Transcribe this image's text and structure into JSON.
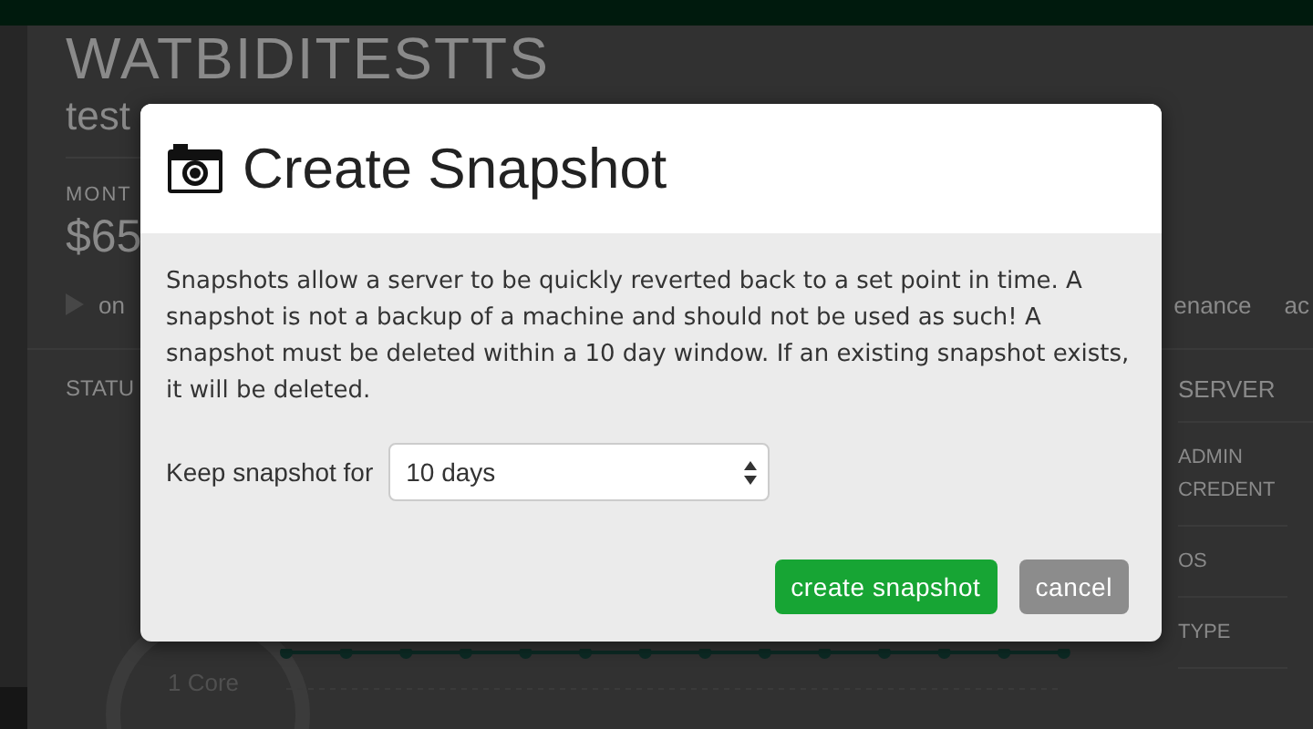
{
  "background": {
    "title": "WATBIDITESTTS",
    "subtitle": "test",
    "stat_label": "MONT",
    "stat_value": "$65",
    "action": "on",
    "tab_1": "enance",
    "tab_2": "ac",
    "status_heading": "STATU",
    "cpu_label": "1 Core",
    "server_heading": "SERVER",
    "server_fields": [
      "ADMIN CREDENT",
      "OS",
      "TYPE"
    ]
  },
  "dialog": {
    "title": "Create Snapshot",
    "description": "Snapshots allow a server to be quickly reverted back to a set point in time. A snapshot is not a backup of a machine and should not be used as such! A snapshot must be deleted within a 10 day window. If an existing snapshot exists, it will be deleted.",
    "keep_label": "Keep snapshot for",
    "keep_value": "10 days",
    "buttons": [
      {
        "label": "create snapshot",
        "kind": "primary"
      },
      {
        "label": "cancel",
        "kind": "secondary"
      }
    ]
  }
}
